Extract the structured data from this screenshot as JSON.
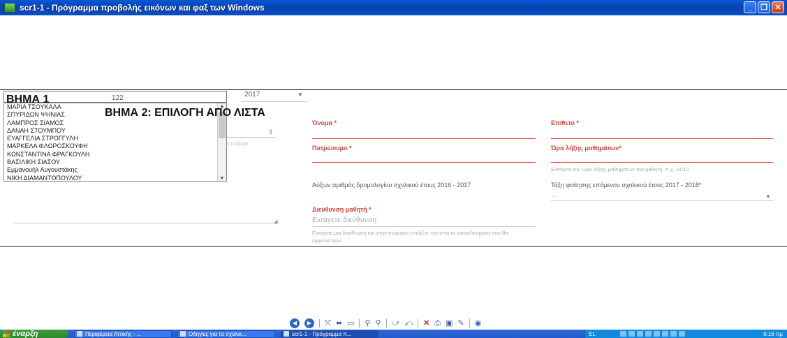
{
  "window": {
    "title": "scr1-1 - Πρόγραμμα προβολής εικόνων και φαξ των Windows",
    "buttons": {
      "minimize": "_",
      "maximize": "❐",
      "close": "✕"
    }
  },
  "capture": {
    "step1_label": "ΒΗΜΑ 1",
    "combo_value": "122",
    "year_value": "2017",
    "step2_label": "ΒΗΜΑ 2: ΕΠΙΛΟΓΗ ΑΠΟ ΛΙΣΤΑ",
    "list_items": [
      "ΜΑΡΙΑ ΤΣΟΥΚΑΛΑ",
      "ΣΠΥΡΙΔΩΝ ΨΗΝΙΑΣ",
      "ΛΑΜΠΡΟΣ ΣΙΑΜΟΣ",
      "ΔΑΝΑΗ ΣΤΟΥΜΠΟΥ",
      "ΕΥΑΓΓΕΛΙΑ ΣΤΡΟΓΓΥΛΗ",
      "ΜΑΡΚΕΛΑ ΦΛΩΡΟΣΚΟΥΦΗ",
      "ΚΩΝΣΤΑΝΤΙΝΑ ΦΡΑΓΚΟΥΛΗ",
      "ΒΑΣΙΛΙΚΗ ΣΙΑΣΟΥ",
      "Εμμανουήλ Αυγουστάκης",
      "ΝΙΚΗ ΔΙΑΜΑΝΤΟΠΟΥΛΟΥ"
    ],
    "faint_text": "ν υπάρχει",
    "form": {
      "first_name_label": "Όνομα *",
      "last_name_label": "Επίθετο *",
      "father_name_label": "Πατρώνυμο *",
      "end_time_label": "Ώρα λήξης μαθημάτων*",
      "end_time_hint": "Εισάγετε την ώρα λήξης μαθημάτων του μαθητή, π.χ. 14:10",
      "route_number_label": "Αύξων αριθμός δρομολογίου σχολικού έτους 2016 - 2017",
      "next_class_label": "Τάξη φοίτησης επόμενου σχολικού έτους 2017 - 2018*",
      "next_class_value": "-",
      "address_label": "Διεύθυνση μαθητή *",
      "address_placeholder": "Εισάγετε διεύθυνση",
      "address_hint": "Εισάγετε μια διεύθυνση και στην συνέχεια επιλέξτε την από τα αποτελέσματα που θα εμφανιστούν"
    }
  },
  "toolbar_icons": [
    "previous-icon",
    "next-icon",
    "best-fit-icon",
    "actual-size-icon",
    "slideshow-icon",
    "zoom-in-icon",
    "zoom-out-icon",
    "rotate-clockwise-icon",
    "rotate-counterclockwise-icon",
    "delete-icon",
    "print-icon",
    "save-icon",
    "edit-icon",
    "help-icon"
  ],
  "taskbar": {
    "start_label": "έναρξη",
    "tasks": [
      {
        "label": "Περιφέρεια Αττικής - ..."
      },
      {
        "label": "Οδηγίες για τα σχολικ..."
      },
      {
        "label": "scr1-1 - Πρόγραμμα π..."
      }
    ],
    "lang": "EL",
    "clock": "9:16 πμ"
  }
}
